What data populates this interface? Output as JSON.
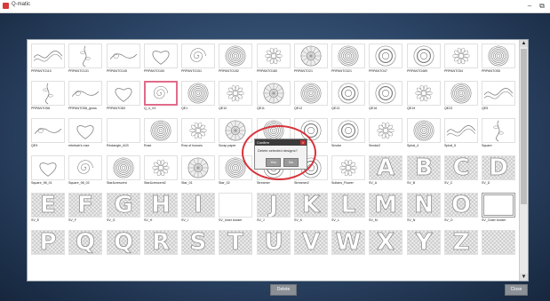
{
  "window": {
    "title": "Q-matic",
    "minimize_label": "–",
    "restore_label": "⧉"
  },
  "rows": [
    [
      "PRPANTO110",
      "PRPANTO131",
      "PRPANTO145",
      "PRPANTO150",
      "PRPANTO151",
      "PRPANTO152",
      "PRPANTO180",
      "PRPANTO21",
      "PRPANTO321",
      "PRPANTO47",
      "PRPANTO489",
      "PRPANTO54",
      "PRPANTO55"
    ],
    [
      "PRPANTO58",
      "PRPANTO58_gross",
      "PRPANTO83",
      "Q_4_V4",
      "QE1",
      "QE10",
      "QE11",
      "QE12",
      "QE13",
      "QE16",
      "QE19",
      "QE23",
      "QE5"
    ],
    [
      "QE9",
      "rebekah's rose",
      "Rectangle_A03",
      "Rose",
      "Row of houses",
      "Scrap paper",
      "",
      "",
      "Smoke",
      "Smoke2",
      "Spiral_4",
      "Spiral_5",
      "Square"
    ],
    [
      "Square_98_01",
      "Square_98_02",
      "Star&crescent",
      "Star&crescent2",
      "Star_01",
      "Star_02",
      "Streamer",
      "Streamer2",
      "Sultans_Flower",
      "SV_A",
      "SV_B",
      "SV_C",
      "SV_D"
    ],
    [
      "SV_E",
      "SV_F",
      "SV_G",
      "SV_H",
      "SV_I",
      "SV_Inner border",
      "SV_J",
      "SV_K",
      "SV_L",
      "SV_M",
      "SV_N",
      "SV_O",
      "SV_Outer border"
    ],
    [
      "",
      "",
      "",
      "",
      "",
      "",
      "",
      "",
      "",
      "",
      "",
      "",
      ""
    ]
  ],
  "letters": {
    "SV_A": "A",
    "SV_B": "B",
    "SV_C": "C",
    "SV_D": "D",
    "SV_E": "E",
    "SV_F": "F",
    "SV_G": "G",
    "SV_H": "H",
    "SV_I": "I",
    "SV_J": "J",
    "SV_K": "K",
    "SV_L": "L",
    "SV_M": "M",
    "SV_N": "N",
    "SV_O": "O"
  },
  "last_row_letters": [
    "P",
    "Q",
    "Q",
    "R",
    "S",
    "T",
    "U",
    "V",
    "W",
    "X",
    "Y",
    "Z",
    ""
  ],
  "selected_design": "Q_4_V4",
  "dialog": {
    "title": "Confirm",
    "message": "Delete selected designs?",
    "yes_label": "Yes",
    "no_label": "No"
  },
  "footer": {
    "delete_label": "Delete",
    "close_label": "Close"
  },
  "colors": {
    "selection": "#e06b8a",
    "dialog_highlight": "#d9323a",
    "background": "#2c4566"
  }
}
